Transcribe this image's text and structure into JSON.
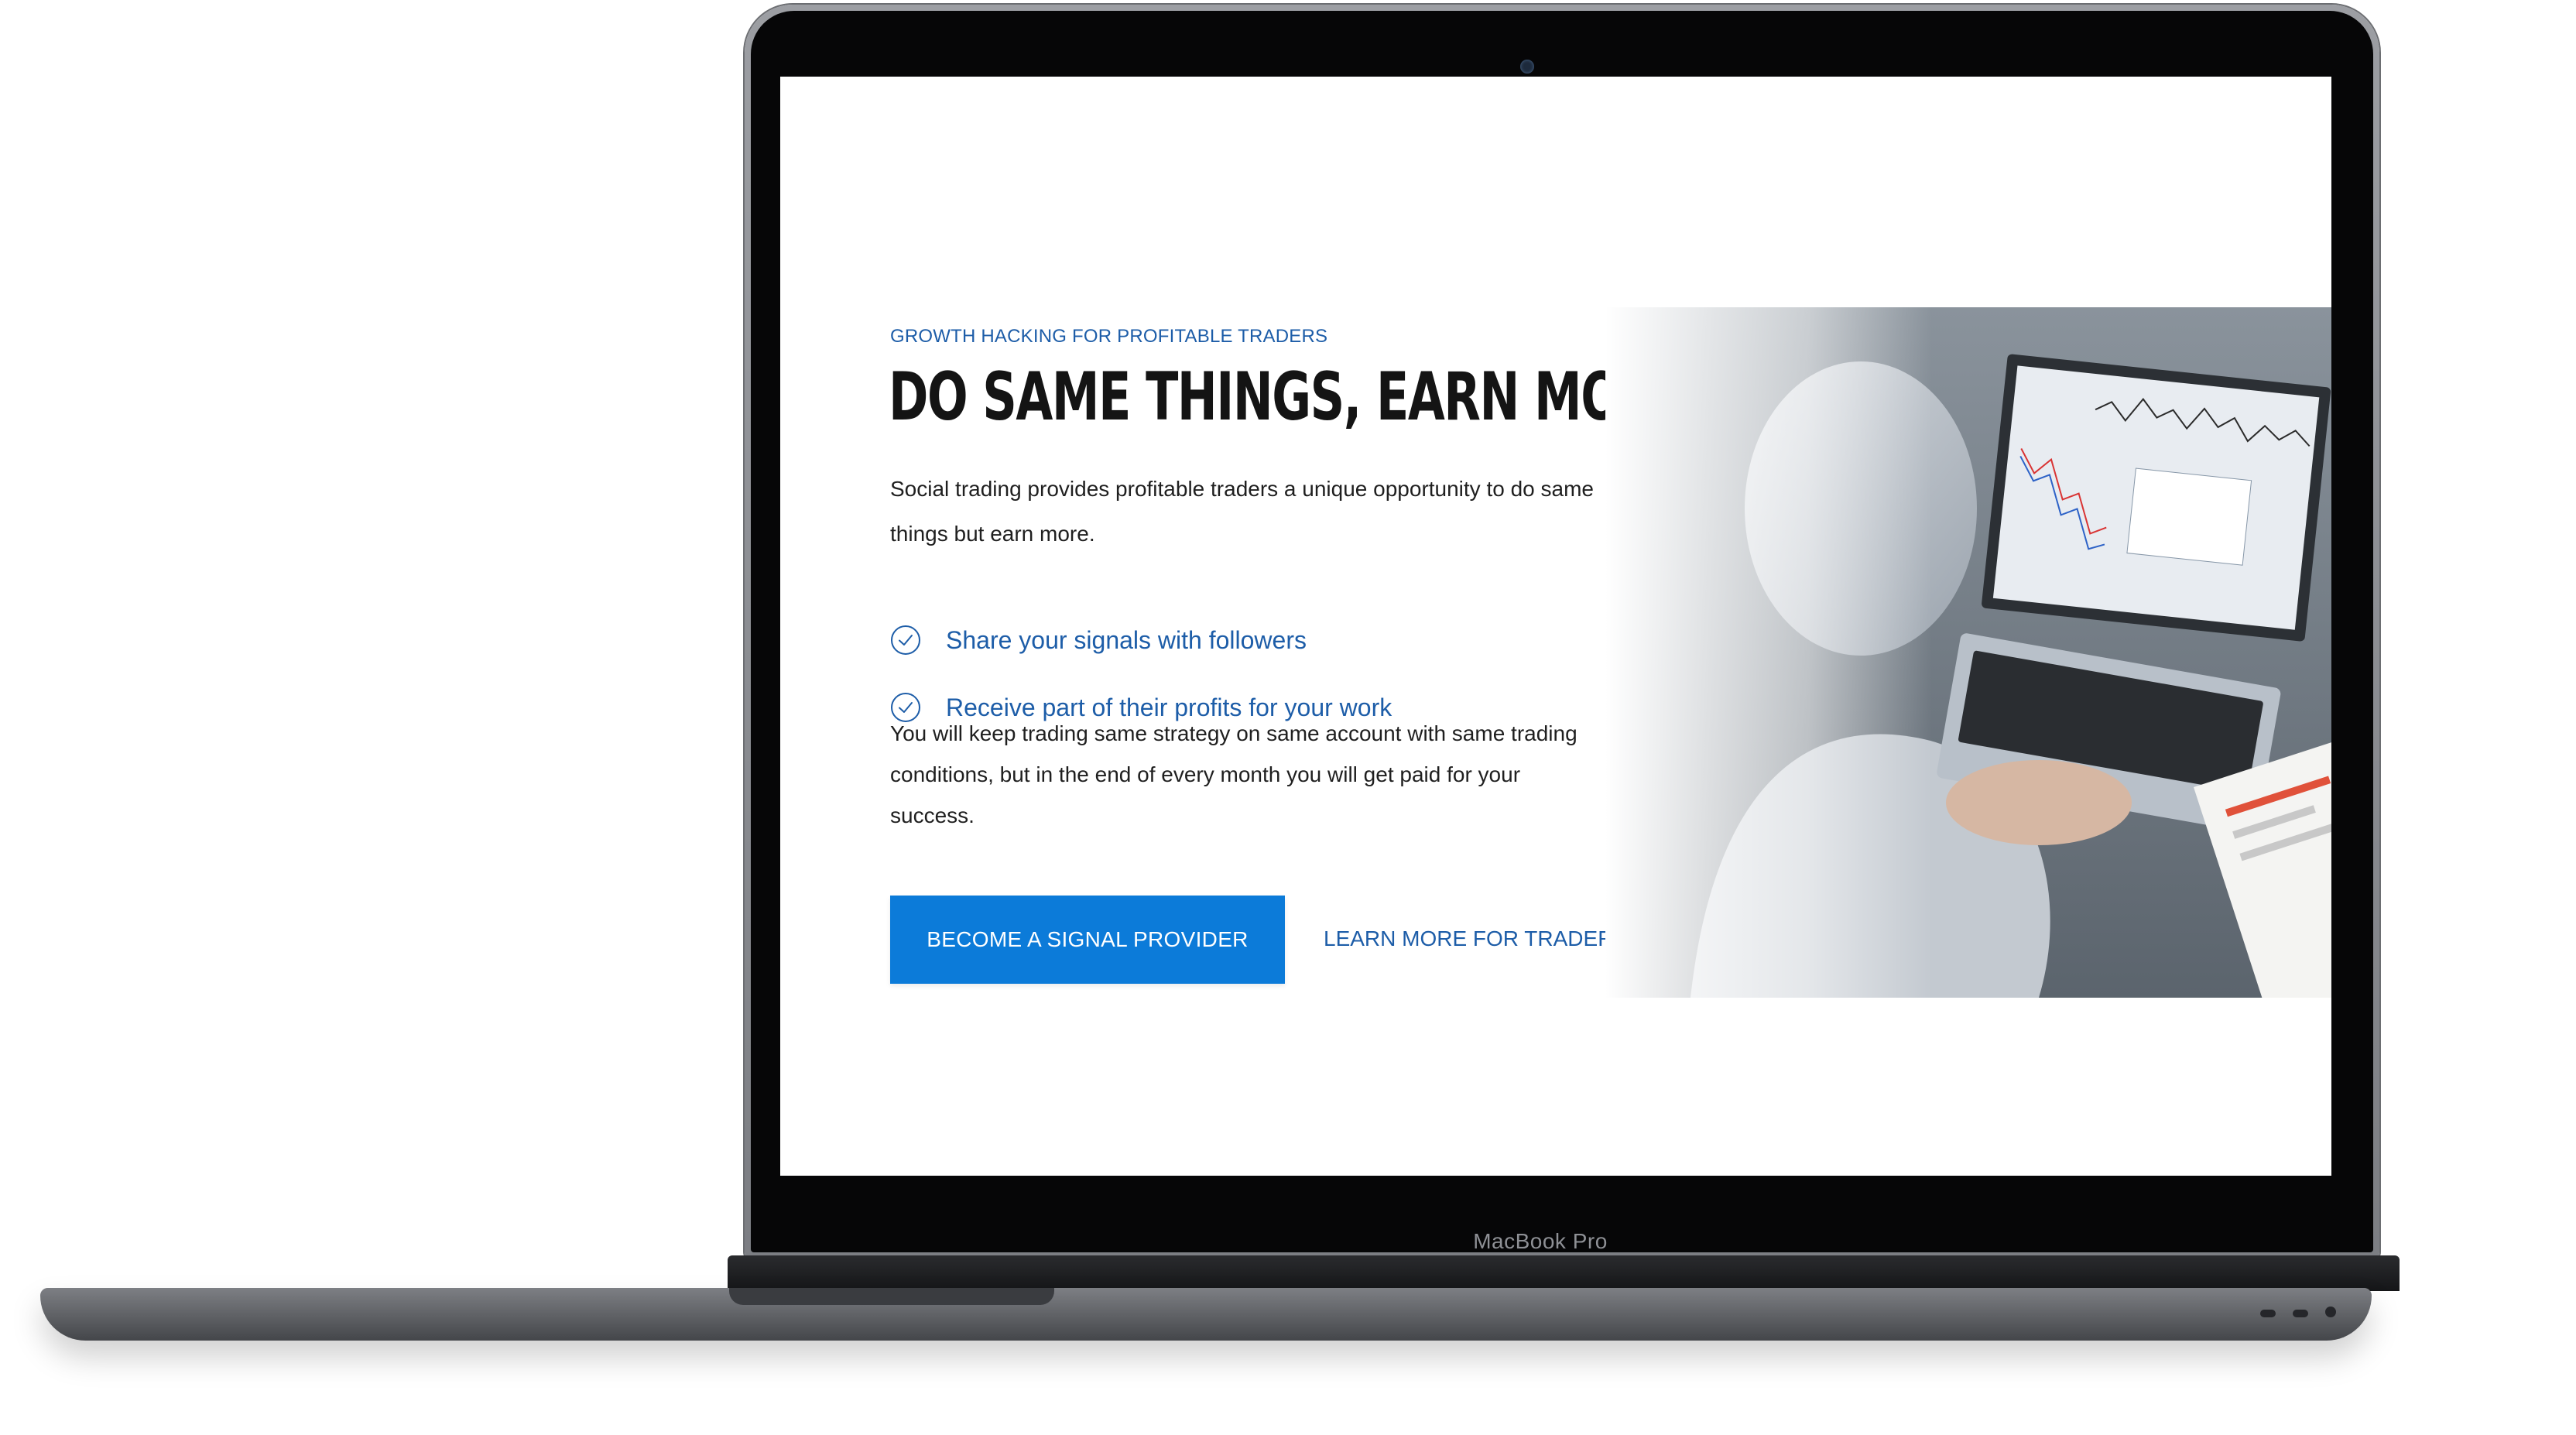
{
  "device": {
    "label": "MacBook Pro"
  },
  "hero": {
    "eyebrow": "GROWTH HACKING FOR PROFITABLE TRADERS",
    "headline": "DO SAME THINGS, EARN MORE",
    "intro": "Social trading provides profitable traders a unique opportunity to do same things but earn more.",
    "benefits": [
      {
        "icon": "check-circle-icon",
        "label": "Share your signals with followers"
      },
      {
        "icon": "check-circle-icon",
        "label": "Receive part of their profits for your work"
      }
    ],
    "body": "You will keep trading same strategy on same account with same trading conditions, but in the end of every month you will get paid for your success.",
    "primary_button": "BECOME A SIGNAL PROVIDER",
    "secondary_link": "LEARN MORE FOR TRADERS"
  },
  "colors": {
    "accent": "#0c7bd9",
    "link": "#1d5da8",
    "headline": "#141414"
  }
}
